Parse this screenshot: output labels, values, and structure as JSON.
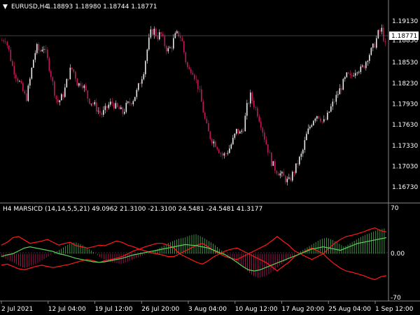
{
  "main_title": {
    "symbol": "EURUSD,H4",
    "ohlc": "1.18893 1.18980 1.18744 1.18771"
  },
  "price_scale": [
    "1.19130",
    "1.18850",
    "1.18530",
    "1.18230",
    "1.17930",
    "1.17630",
    "1.17330",
    "1.17030",
    "1.16730"
  ],
  "current_price_label": "1.18771",
  "indicator_title": "H4 MARSICD (14,14,5,5,21) 49.0962 21.3100 -21.3100 24.5481 -24.5481 41.3177",
  "indicator_scale": [
    "70",
    "0.00",
    "-70"
  ],
  "time_axis": [
    "2 Jul 2021",
    "12 Jul 04:00",
    "19 Jul 12:00",
    "26 Jul 20:00",
    "3 Aug 04:00",
    "10 Aug 12:00",
    "17 Aug 20:00",
    "25 Aug 04:00",
    "1 Sep 12:00"
  ],
  "colors": {
    "background": "#000000",
    "grid": "#888888",
    "candle_up": "#e8e8e8",
    "candle_down": "#c2185b",
    "red_line": "#ff1a1a",
    "green_line": "#5ad35a",
    "hist_up": "#4caf50",
    "hist_down": "#b71c5c"
  },
  "chart_data": {
    "type": "candlestick",
    "price_ylim": [
      1.1655,
      1.1925
    ],
    "close_path": [
      1.1885,
      1.1888,
      1.187,
      1.1848,
      1.1835,
      1.1825,
      1.1812,
      1.18,
      1.1825,
      1.1855,
      1.1875,
      1.1868,
      1.1878,
      1.186,
      1.184,
      1.1815,
      1.1795,
      1.18,
      1.181,
      1.183,
      1.1845,
      1.1838,
      1.182,
      1.1825,
      1.1815,
      1.18,
      1.1795,
      1.179,
      1.1782,
      1.1778,
      1.1785,
      1.1792,
      1.1795,
      1.1788,
      1.1785,
      1.178,
      1.179,
      1.1795,
      1.18,
      1.181,
      1.1825,
      1.184,
      1.187,
      1.1895,
      1.19,
      1.189,
      1.1895,
      1.188,
      1.187,
      1.1875,
      1.189,
      1.1895,
      1.1888,
      1.186,
      1.184,
      1.1845,
      1.183,
      1.1815,
      1.179,
      1.1765,
      1.1748,
      1.174,
      1.1735,
      1.1725,
      1.1718,
      1.1722,
      1.173,
      1.1742,
      1.1755,
      1.175,
      1.176,
      1.179,
      1.1805,
      1.1792,
      1.178,
      1.1765,
      1.1745,
      1.1728,
      1.171,
      1.17,
      1.1695,
      1.169,
      1.1685,
      1.168,
      1.169,
      1.17,
      1.1712,
      1.1722,
      1.1745,
      1.1758,
      1.177,
      1.1778,
      1.1775,
      1.1765,
      1.1772,
      1.1785,
      1.1795,
      1.1805,
      1.1815,
      1.1825,
      1.1835,
      1.183,
      1.184,
      1.1845,
      1.1842,
      1.185,
      1.1862,
      1.187,
      1.188,
      1.1895,
      1.19,
      1.1877
    ],
    "indicator_ylim": [
      -70,
      70
    ],
    "red_upper": [
      15,
      20,
      28,
      30,
      24,
      18,
      20,
      22,
      25,
      20,
      15,
      18,
      20,
      14,
      12,
      10,
      12,
      15,
      14,
      18,
      22,
      20,
      15,
      12,
      8,
      12,
      15,
      18,
      18,
      15,
      10,
      0,
      -5,
      -10,
      -15,
      -18,
      -12,
      -5,
      0,
      5,
      8,
      10,
      5,
      0,
      5,
      10,
      15,
      22,
      30,
      22,
      15,
      5,
      0,
      -5,
      -10,
      -5,
      0,
      -10,
      -18,
      -25,
      -30,
      -32,
      -35,
      -38,
      -42,
      -45,
      -40,
      -38
    ],
    "red_lower": [
      -20,
      -18,
      -22,
      -26,
      -28,
      -25,
      -22,
      -20,
      -22,
      -24,
      -22,
      -20,
      -18,
      -15,
      -12,
      -10,
      -12,
      -15,
      -12,
      -10,
      -8,
      -5,
      0,
      5,
      8,
      5,
      2,
      0,
      -2,
      -5,
      -5,
      0,
      5,
      10,
      15,
      18,
      12,
      5,
      0,
      -5,
      -8,
      -10,
      -5,
      0,
      -5,
      -10,
      -15,
      -22,
      -30,
      -22,
      -15,
      -5,
      0,
      5,
      10,
      5,
      0,
      10,
      18,
      25,
      30,
      32,
      35,
      38,
      42,
      45,
      40,
      38
    ],
    "green_line": [
      -5,
      -2,
      0,
      5,
      10,
      12,
      10,
      8,
      6,
      4,
      0,
      -2,
      -5,
      -8,
      -10,
      -12,
      -14,
      -15,
      -14,
      -12,
      -10,
      -8,
      -5,
      -2,
      0,
      2,
      4,
      6,
      8,
      10,
      12,
      14,
      16,
      15,
      14,
      12,
      10,
      6,
      2,
      -2,
      -8,
      -15,
      -22,
      -28,
      -30,
      -28,
      -24,
      -20,
      -16,
      -12,
      -8,
      -4,
      0,
      4,
      8,
      10,
      12,
      10,
      8,
      6,
      10,
      14,
      18,
      20,
      22,
      24,
      26,
      28
    ],
    "histogram": [
      -5,
      -10,
      -15,
      -20,
      -25,
      -22,
      -18,
      -12,
      -6,
      0,
      6,
      12,
      18,
      20,
      16,
      10,
      4,
      -4,
      -10,
      -14,
      -16,
      -18,
      -14,
      -10,
      -6,
      -2,
      2,
      6,
      12,
      18,
      22,
      26,
      28,
      32,
      34,
      30,
      24,
      18,
      10,
      2,
      -6,
      -14,
      -22,
      -30,
      -38,
      -42,
      -40,
      -34,
      -26,
      -18,
      -10,
      -4,
      2,
      8,
      14,
      20,
      26,
      28,
      24,
      18,
      12,
      18,
      24,
      30,
      34,
      38,
      42,
      44
    ]
  }
}
